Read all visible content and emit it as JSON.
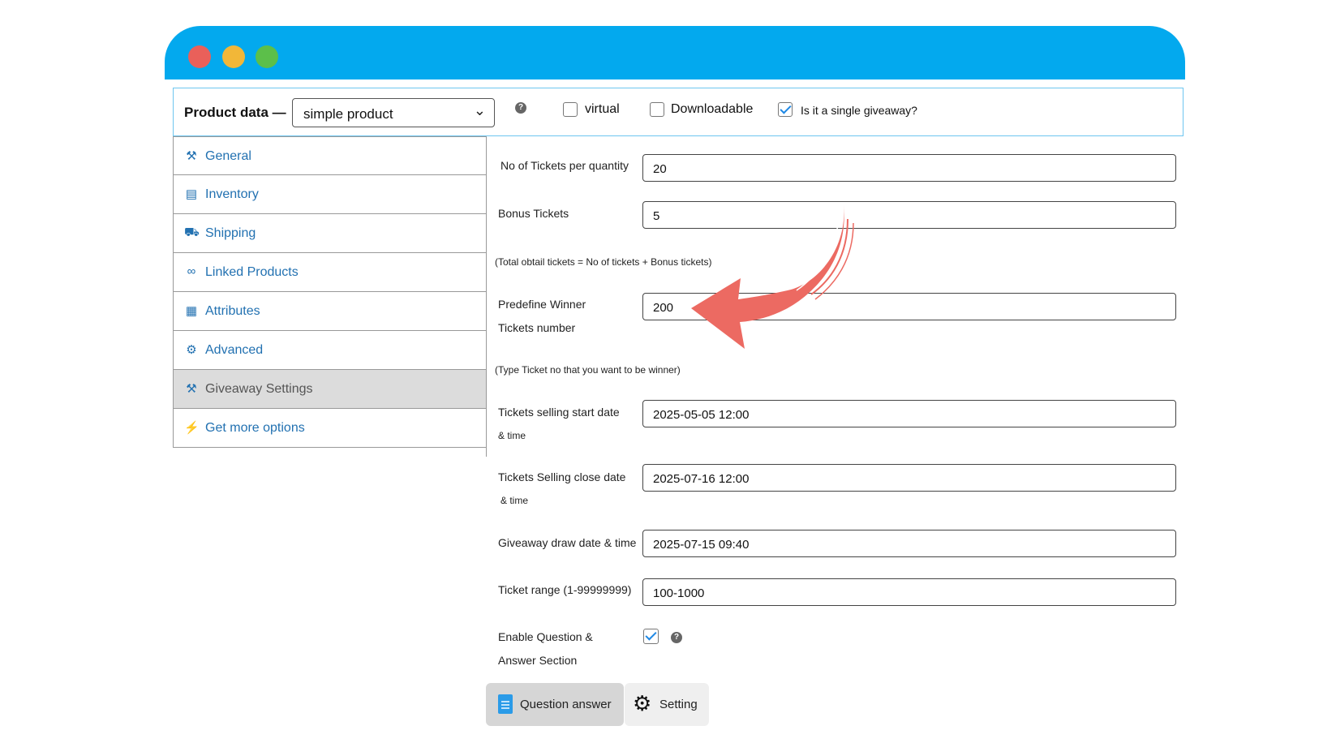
{
  "product_data": {
    "title": "Product data —",
    "type_value": "simple product",
    "virtual_label": "virtual",
    "downloadable_label": "Downloadable",
    "giveaway_label": "Is it a single giveaway?"
  },
  "sidebar": {
    "items": [
      {
        "label": "General",
        "icon": "wrench-icon"
      },
      {
        "label": "Inventory",
        "icon": "inventory-icon"
      },
      {
        "label": "Shipping",
        "icon": "truck-icon"
      },
      {
        "label": "Linked Products",
        "icon": "link-icon"
      },
      {
        "label": "Attributes",
        "icon": "attributes-icon"
      },
      {
        "label": "Advanced",
        "icon": "gear-icon"
      },
      {
        "label": "Giveaway Settings",
        "icon": "wrench-icon"
      },
      {
        "label": "Get more options",
        "icon": "plug-icon"
      }
    ],
    "active_index": 6
  },
  "form": {
    "tickets_per_qty": {
      "label": "No of Tickets per quantity",
      "value": "20"
    },
    "bonus": {
      "label": "Bonus Tickets",
      "value": "5"
    },
    "bonus_note": "(Total obtail tickets = No of tickets + Bonus tickets)",
    "predefine": {
      "label_line1": "Predefine Winner",
      "label_line2": "Tickets number",
      "value": "200"
    },
    "predefine_note": "(Type Ticket no that you want to be winner)",
    "start": {
      "label": "Tickets selling start date",
      "sub": "& time",
      "value": "2025-05-05  12:00"
    },
    "close": {
      "label": "Tickets Selling close date",
      "sub": "& time",
      "value": "2025-07-16 12:00"
    },
    "draw": {
      "label": "Giveaway draw date & time",
      "value": "2025-07-15 09:40"
    },
    "range": {
      "label": "Ticket range (1-99999999)",
      "value": "100-1000"
    },
    "qa": {
      "label_line1": "Enable Question &",
      "label_line2": "Answer Section"
    }
  },
  "tabs": {
    "question_answer": "Question answer",
    "setting": "Setting"
  },
  "colors": {
    "titlebar": "#03a9ee",
    "link": "#2271b1",
    "arrow": "#ec6a62"
  }
}
